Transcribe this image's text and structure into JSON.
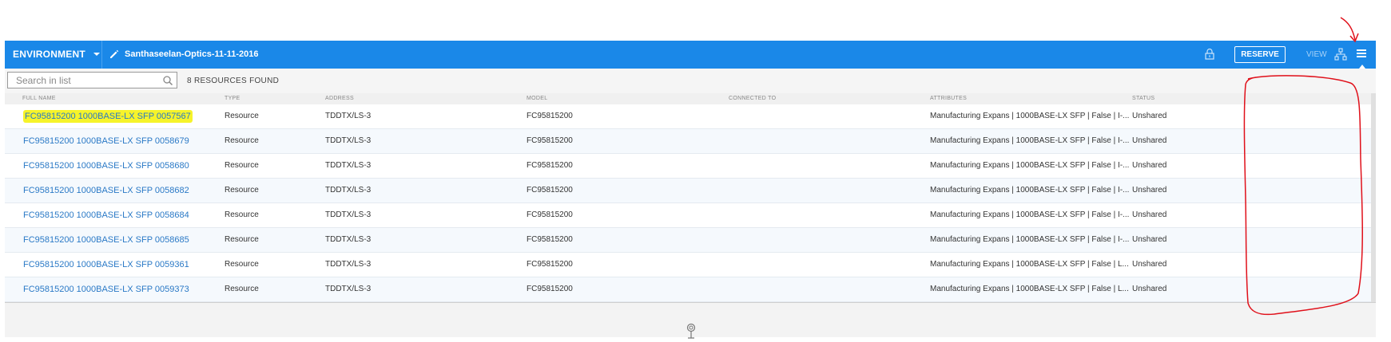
{
  "topbar": {
    "environment_label": "ENVIRONMENT",
    "reservation_name": "Santhaseelan-Optics-11-11-2016",
    "reserve_button": "RESERVE",
    "view_label": "VIEW"
  },
  "search": {
    "placeholder": "Search in list",
    "results_count": "8 RESOURCES FOUND"
  },
  "table": {
    "columns": [
      "FULL NAME",
      "TYPE",
      "ADDRESS",
      "MODEL",
      "CONNECTED TO",
      "ATTRIBUTES",
      "STATUS"
    ],
    "rows": [
      {
        "name": "FC95815200 1000BASE-LX SFP 0057567",
        "type": "Resource",
        "address": "TDDTX/LS-3",
        "model": "FC95815200",
        "connected": "",
        "attributes": "Manufacturing Expans | 1000BASE-LX SFP | False | I-...",
        "status": "Unshared"
      },
      {
        "name": "FC95815200 1000BASE-LX SFP 0058679",
        "type": "Resource",
        "address": "TDDTX/LS-3",
        "model": "FC95815200",
        "connected": "",
        "attributes": "Manufacturing Expans | 1000BASE-LX SFP | False | I-...",
        "status": "Unshared"
      },
      {
        "name": "FC95815200 1000BASE-LX SFP 0058680",
        "type": "Resource",
        "address": "TDDTX/LS-3",
        "model": "FC95815200",
        "connected": "",
        "attributes": "Manufacturing Expans | 1000BASE-LX SFP | False | I-...",
        "status": "Unshared"
      },
      {
        "name": "FC95815200 1000BASE-LX SFP 0058682",
        "type": "Resource",
        "address": "TDDTX/LS-3",
        "model": "FC95815200",
        "connected": "",
        "attributes": "Manufacturing Expans | 1000BASE-LX SFP | False | I-...",
        "status": "Unshared"
      },
      {
        "name": "FC95815200 1000BASE-LX SFP 0058684",
        "type": "Resource",
        "address": "TDDTX/LS-3",
        "model": "FC95815200",
        "connected": "",
        "attributes": "Manufacturing Expans | 1000BASE-LX SFP | False | I-...",
        "status": "Unshared"
      },
      {
        "name": "FC95815200 1000BASE-LX SFP 0058685",
        "type": "Resource",
        "address": "TDDTX/LS-3",
        "model": "FC95815200",
        "connected": "",
        "attributes": "Manufacturing Expans | 1000BASE-LX SFP | False | I-...",
        "status": "Unshared"
      },
      {
        "name": "FC95815200 1000BASE-LX SFP 0059361",
        "type": "Resource",
        "address": "TDDTX/LS-3",
        "model": "FC95815200",
        "connected": "",
        "attributes": "Manufacturing Expans | 1000BASE-LX SFP | False | L...",
        "status": "Unshared"
      },
      {
        "name": "FC95815200 1000BASE-LX SFP 0059373",
        "type": "Resource",
        "address": "TDDTX/LS-3",
        "model": "FC95815200",
        "connected": "",
        "attributes": "Manufacturing Expans | 1000BASE-LX SFP | False | L...",
        "status": "Unshared"
      }
    ]
  },
  "colors": {
    "topbar": "#1a88e8",
    "link": "#2a79c6",
    "highlight": "#f6f32a",
    "annotation": "#e0101a"
  },
  "icons": [
    "chevron-down-icon",
    "pencil-icon",
    "lock-icon",
    "tree-view-icon",
    "list-view-icon",
    "search-icon",
    "pin-icon"
  ]
}
